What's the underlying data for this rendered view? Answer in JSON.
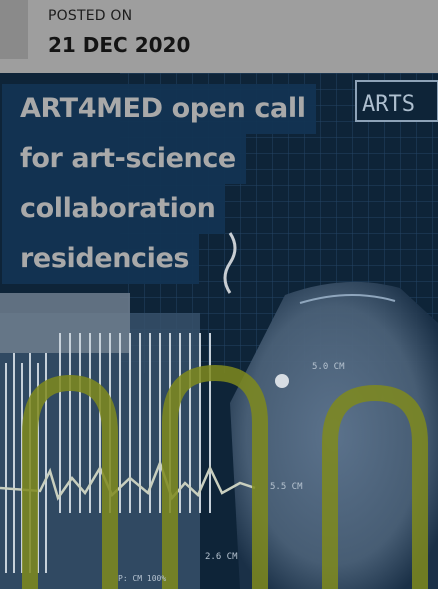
{
  "post": {
    "posted_on_label": "POSTED ON",
    "date": "21 DEC 2020",
    "title_lines": [
      "ART4MED open call",
      "for art-science",
      "collaboration",
      "residencies"
    ]
  },
  "hero_image": {
    "overlay_text": "ARTS",
    "measure_labels": [
      "5.0 CM",
      "5.5 CM",
      "2.6 CM",
      "P: CM 100%"
    ]
  },
  "colors": {
    "meta_background": "#9e9e9e",
    "title_background": "#133452",
    "title_text": "#a9a9a9",
    "hero_background": "#0d2236",
    "accent_yellow": "#8a8a1e"
  }
}
